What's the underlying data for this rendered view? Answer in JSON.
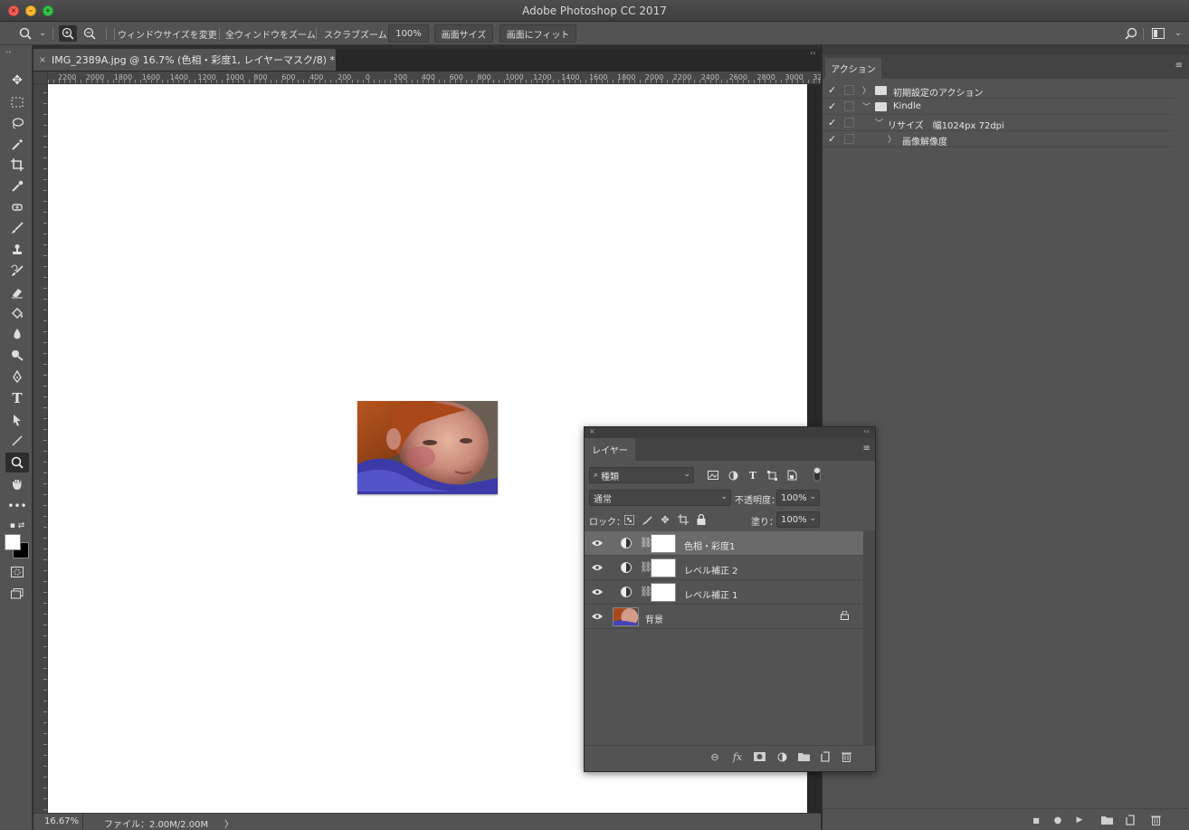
{
  "window": {
    "title": "Adobe Photoshop CC 2017"
  },
  "optionsbar": {
    "resize_windows": "ウィンドウサイズを変更",
    "zoom_all": "全ウィンドウをズーム",
    "scrubby_zoom": "スクラブズーム",
    "zoom_value": "100%",
    "actual_size": "画面サイズ",
    "fit_screen": "画面にフィット"
  },
  "document": {
    "tab_title": "IMG_2389A.jpg @ 16.7% (色相・彩度1, レイヤーマスク/8) *",
    "ruler_labels": [
      "2200",
      "2000",
      "1800",
      "1600",
      "1400",
      "1200",
      "1000",
      "800",
      "600",
      "400",
      "200",
      "0",
      "200",
      "400",
      "600",
      "800",
      "1000",
      "1200",
      "1400",
      "1600",
      "1800",
      "2000",
      "2200",
      "2400",
      "2600",
      "2800",
      "3000",
      "3200"
    ],
    "zoom_status": "16.67%",
    "file_status": "ファイル：2.00M/2.00M",
    "status_arrow": "〉"
  },
  "actions_panel": {
    "tab": "アクション",
    "rows": [
      {
        "checked": "✓",
        "twisty": "〉",
        "label": "初期設定のアクション"
      },
      {
        "checked": "✓",
        "twisty": "﹀",
        "label": "Kindle"
      },
      {
        "checked": "✓",
        "twisty": "﹀",
        "label": "リサイズ　幅1024px 72dpi"
      },
      {
        "checked": "✓",
        "twisty": "〉",
        "label": "画像解像度"
      }
    ]
  },
  "layers_panel": {
    "tab": "レイヤー",
    "filter": "種類",
    "blend_mode": "通常",
    "opacity_label": "不透明度：",
    "opacity_value": "100%",
    "lock_label": "ロック：",
    "fill_label": "塗り：",
    "fill_value": "100%",
    "layers": [
      {
        "name": "色相・彩度1",
        "selected": true
      },
      {
        "name": "レベル補正 2",
        "selected": false
      },
      {
        "name": "レベル補正 1",
        "selected": false
      },
      {
        "name": "背景",
        "selected": false
      }
    ]
  },
  "colors": {
    "panel_bg": "#535353",
    "canvas": "#ffffff",
    "selected_layer": "#6a6a6a",
    "traffic_close": "#fc5f57",
    "traffic_min": "#fdbc2e",
    "traffic_max": "#33c748"
  }
}
